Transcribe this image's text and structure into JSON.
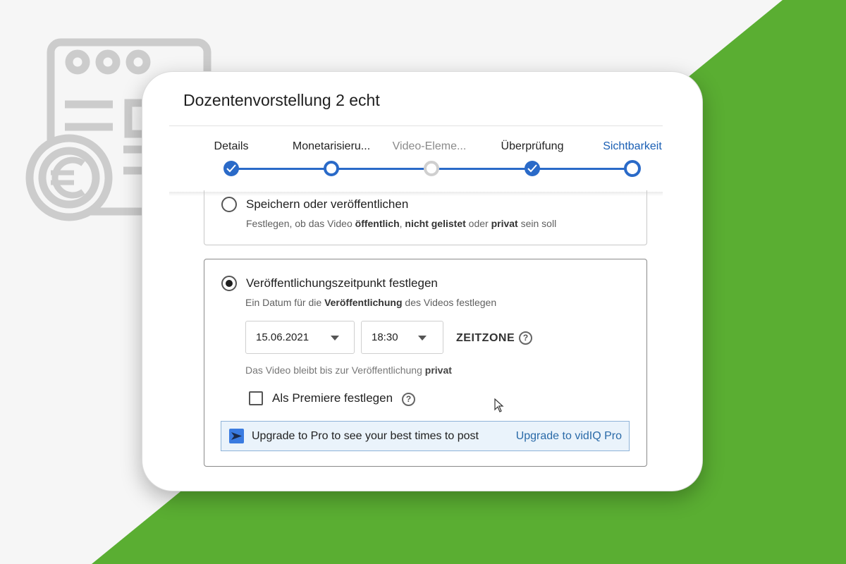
{
  "colors": {
    "accent": "#2a6ac8",
    "green": "#5aae32",
    "page_bg": "#f6f6f6",
    "banner_bg": "#eaf3fb"
  },
  "dialog": {
    "title": "Dozentenvorstellung 2 echt"
  },
  "stepper": {
    "steps": [
      {
        "label": "Details",
        "state": "done"
      },
      {
        "label": "Monetarisieru...",
        "state": "open"
      },
      {
        "label": "Video-Eleme...",
        "state": "disabled"
      },
      {
        "label": "Überprüfung",
        "state": "done"
      },
      {
        "label": "Sichtbarkeit",
        "state": "current"
      }
    ]
  },
  "options": {
    "save_publish": {
      "title": "Speichern oder veröffentlichen",
      "desc_parts": [
        "Festlegen, ob das Video ",
        "öffentlich",
        ", ",
        "nicht gelistet",
        " oder ",
        "privat",
        " sein soll"
      ],
      "selected": false
    },
    "schedule": {
      "title": "Veröffentlichungszeitpunkt festlegen",
      "desc_parts": [
        "Ein Datum für die ",
        "Veröffentlichung",
        " des Videos festlegen"
      ],
      "selected": true,
      "date": "15.06.2021",
      "time": "18:30",
      "timezone_label": "ZEITZONE",
      "help_glyph": "?",
      "note_parts": [
        "Das Video bleibt bis zur Veröffentlichung ",
        "privat"
      ],
      "premiere_label": "Als Premiere festlegen",
      "premiere_checked": false
    }
  },
  "banner": {
    "logo_icon": "vidiq-logo-icon",
    "message": "Upgrade to Pro to see your best times to post",
    "link": "Upgrade to vidIQ Pro"
  }
}
